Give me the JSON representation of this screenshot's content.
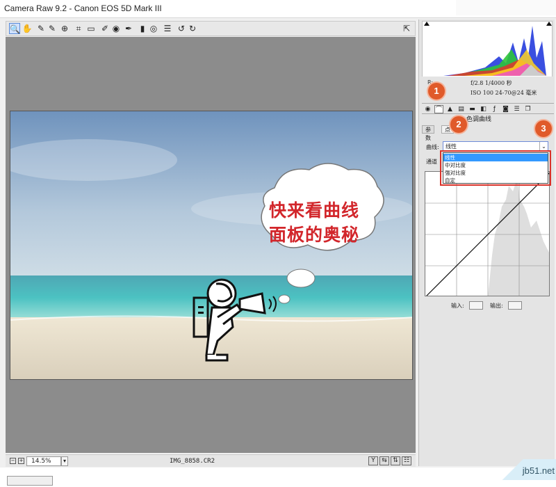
{
  "window": {
    "title": "Camera Raw 9.2 -  Canon EOS 5D Mark III"
  },
  "toolbar": {
    "tools": [
      {
        "name": "zoom-tool",
        "glyph": "🔍"
      },
      {
        "name": "hand-tool",
        "glyph": "✋"
      },
      {
        "name": "white-balance-tool",
        "glyph": "✎"
      },
      {
        "name": "color-sampler-tool",
        "glyph": "✎"
      },
      {
        "name": "targeted-adjustment-tool",
        "glyph": "⊕"
      },
      {
        "name": "crop-tool",
        "glyph": "⌗"
      },
      {
        "name": "straighten-tool",
        "glyph": "▭"
      },
      {
        "name": "spot-removal-tool",
        "glyph": "✐"
      },
      {
        "name": "red-eye-tool",
        "glyph": "◉"
      },
      {
        "name": "adjustment-brush-tool",
        "glyph": "✒"
      },
      {
        "name": "graduated-filter-tool",
        "glyph": "▮"
      },
      {
        "name": "radial-filter-tool",
        "glyph": "◎"
      },
      {
        "name": "preferences-tool",
        "glyph": "☰"
      },
      {
        "name": "rotate-ccw-tool",
        "glyph": "↺"
      },
      {
        "name": "rotate-cw-tool",
        "glyph": "↻"
      }
    ],
    "fullscreen_glyph": "⇱"
  },
  "photo": {
    "callout_line1": "快来看曲线",
    "callout_line2": "面板的奥秘"
  },
  "bottombar": {
    "zoom_value": "14.5%",
    "filename": "IMG_8858.CR2"
  },
  "panel": {
    "rgb_label": "R:",
    "camera_line1": "f/2.8   1/4000 秒",
    "camera_line2": "ISO 100   24-70@24 毫米",
    "section_title": "色调曲线",
    "subtabs": [
      "参数",
      "点"
    ],
    "curve_label": "曲线:",
    "curve_value": "线性",
    "channel_label": "通道",
    "dropdown_options": [
      "线性",
      "中对比度",
      "强对比度",
      "自定"
    ],
    "input_label": "输入:",
    "output_label": "输出:"
  },
  "badges": [
    "1",
    "2",
    "3"
  ],
  "watermark": "jb51.net",
  "colors": {
    "badge": "#e05a2a",
    "highlight_box": "#d9322a",
    "selection": "#3399ff"
  }
}
